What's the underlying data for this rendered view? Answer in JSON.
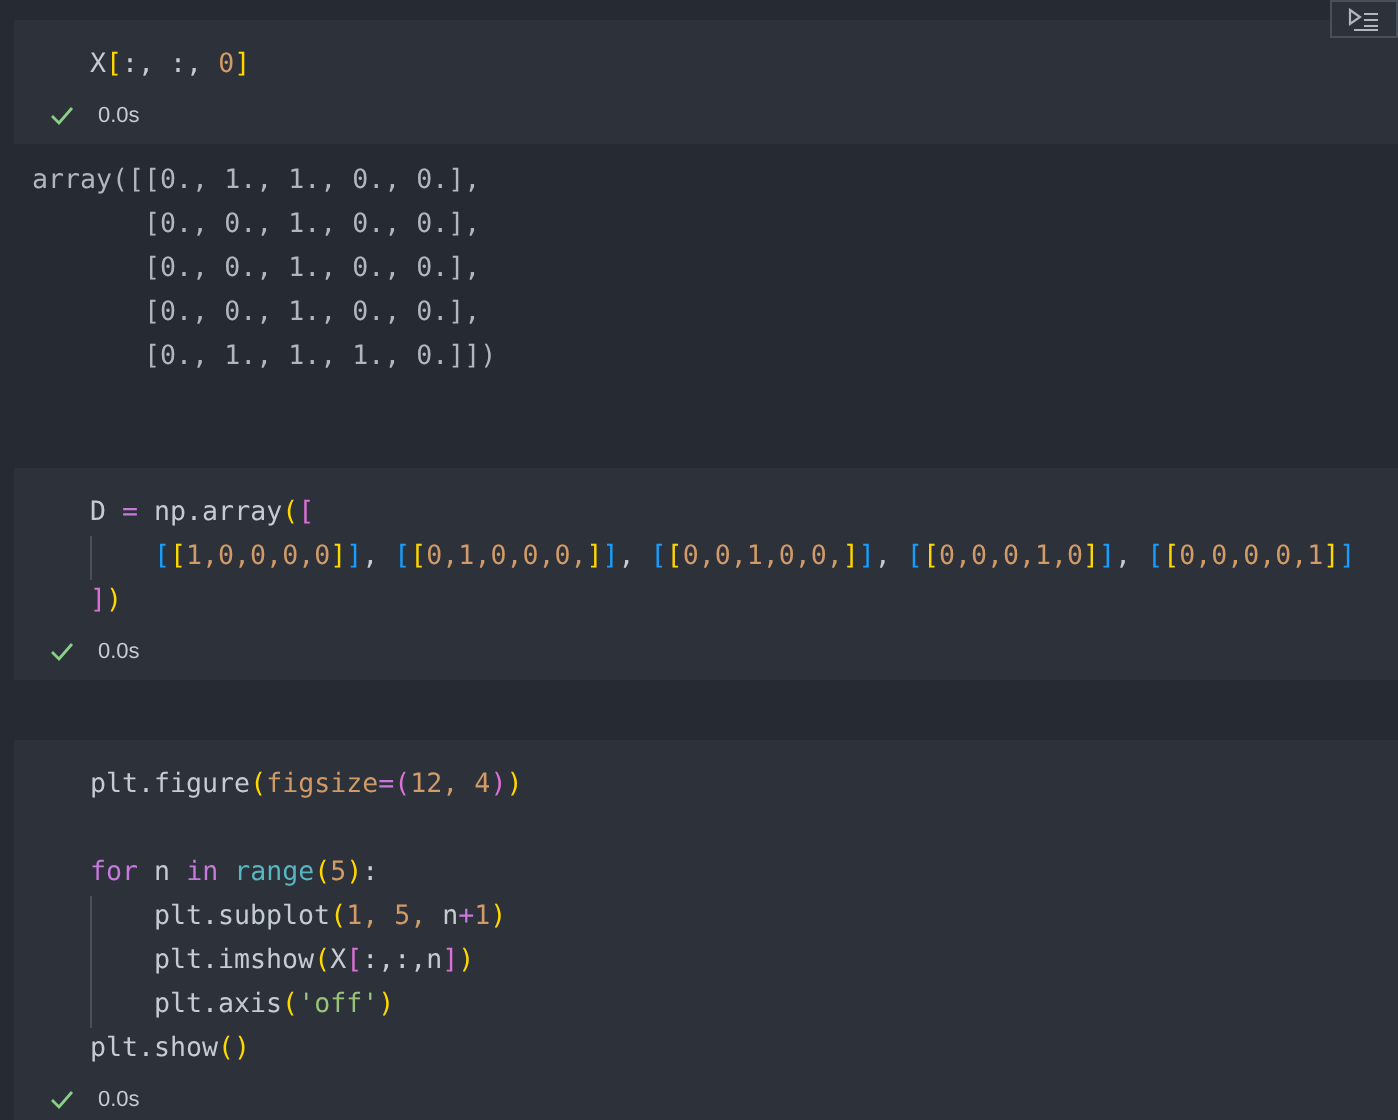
{
  "cells": [
    {
      "code": [
        {
          "tokens": [
            {
              "text": "X",
              "kind": "plain"
            },
            {
              "text": "[",
              "kind": "bracket1"
            },
            {
              "text": ":, :, ",
              "kind": "plain"
            },
            {
              "text": "0",
              "kind": "number"
            },
            {
              "text": "]",
              "kind": "bracket1"
            }
          ]
        }
      ],
      "status": {
        "ok": true,
        "time": "0.0s"
      },
      "output": [
        "array([[0., 1., 1., 0., 0.],",
        "       [0., 0., 1., 0., 0.],",
        "       [0., 0., 1., 0., 0.],",
        "       [0., 0., 1., 0., 0.],",
        "       [0., 1., 1., 1., 0.]])"
      ]
    },
    {
      "code": [
        {
          "tokens": [
            {
              "text": "D ",
              "kind": "plain"
            },
            {
              "text": "=",
              "kind": "operator"
            },
            {
              "text": " np.array",
              "kind": "plain"
            },
            {
              "text": "(",
              "kind": "bracket1"
            },
            {
              "text": "[",
              "kind": "bracket2"
            }
          ]
        },
        {
          "indented": true,
          "tokens": [
            {
              "text": "[",
              "kind": "bracket3"
            },
            {
              "text": "[",
              "kind": "bracket1"
            },
            {
              "text": "1,0,0,0,0",
              "kind": "number"
            },
            {
              "text": "]",
              "kind": "bracket1"
            },
            {
              "text": "]",
              "kind": "bracket3"
            },
            {
              "text": ", ",
              "kind": "plain"
            },
            {
              "text": "[",
              "kind": "bracket3"
            },
            {
              "text": "[",
              "kind": "bracket1"
            },
            {
              "text": "0,1,0,0,0,",
              "kind": "number"
            },
            {
              "text": "]",
              "kind": "bracket1"
            },
            {
              "text": "]",
              "kind": "bracket3"
            },
            {
              "text": ", ",
              "kind": "plain"
            },
            {
              "text": "[",
              "kind": "bracket3"
            },
            {
              "text": "[",
              "kind": "bracket1"
            },
            {
              "text": "0,0,1,0,0,",
              "kind": "number"
            },
            {
              "text": "]",
              "kind": "bracket1"
            },
            {
              "text": "]",
              "kind": "bracket3"
            },
            {
              "text": ", ",
              "kind": "plain"
            },
            {
              "text": "[",
              "kind": "bracket3"
            },
            {
              "text": "[",
              "kind": "bracket1"
            },
            {
              "text": "0,0,0,1,0",
              "kind": "number"
            },
            {
              "text": "]",
              "kind": "bracket1"
            },
            {
              "text": "]",
              "kind": "bracket3"
            },
            {
              "text": ", ",
              "kind": "plain"
            },
            {
              "text": "[",
              "kind": "bracket3"
            },
            {
              "text": "[",
              "kind": "bracket1"
            },
            {
              "text": "0,0,0,0,1",
              "kind": "number"
            },
            {
              "text": "]",
              "kind": "bracket1"
            },
            {
              "text": "]",
              "kind": "bracket3"
            }
          ]
        },
        {
          "tokens": [
            {
              "text": "]",
              "kind": "bracket2"
            },
            {
              "text": ")",
              "kind": "bracket1"
            }
          ]
        }
      ],
      "status": {
        "ok": true,
        "time": "0.0s"
      }
    },
    {
      "code": [
        {
          "tokens": [
            {
              "text": "plt.figure",
              "kind": "plain"
            },
            {
              "text": "(",
              "kind": "bracket1"
            },
            {
              "text": "figsize",
              "kind": "number"
            },
            {
              "text": "=",
              "kind": "operator"
            },
            {
              "text": "(",
              "kind": "bracket2"
            },
            {
              "text": "12, 4",
              "kind": "number"
            },
            {
              "text": ")",
              "kind": "bracket2"
            },
            {
              "text": ")",
              "kind": "bracket1"
            }
          ]
        },
        {
          "gap_before": true,
          "tokens": [
            {
              "text": "for",
              "kind": "keyword"
            },
            {
              "text": " n ",
              "kind": "plain"
            },
            {
              "text": "in",
              "kind": "keyword"
            },
            {
              "text": " range",
              "kind": "function"
            },
            {
              "text": "(",
              "kind": "bracket1"
            },
            {
              "text": "5",
              "kind": "number"
            },
            {
              "text": ")",
              "kind": "bracket1"
            },
            {
              "text": ":",
              "kind": "plain"
            }
          ]
        },
        {
          "indented": true,
          "tokens": [
            {
              "text": "plt.subplot",
              "kind": "plain"
            },
            {
              "text": "(",
              "kind": "bracket1"
            },
            {
              "text": "1, 5, ",
              "kind": "number"
            },
            {
              "text": "n",
              "kind": "plain"
            },
            {
              "text": "+",
              "kind": "operator"
            },
            {
              "text": "1",
              "kind": "number"
            },
            {
              "text": ")",
              "kind": "bracket1"
            }
          ]
        },
        {
          "indented": true,
          "tokens": [
            {
              "text": "plt.imshow",
              "kind": "plain"
            },
            {
              "text": "(",
              "kind": "bracket1"
            },
            {
              "text": "X",
              "kind": "plain"
            },
            {
              "text": "[",
              "kind": "bracket2"
            },
            {
              "text": ":,:,n",
              "kind": "plain"
            },
            {
              "text": "]",
              "kind": "bracket2"
            },
            {
              "text": ")",
              "kind": "bracket1"
            }
          ]
        },
        {
          "indented": true,
          "tokens": [
            {
              "text": "plt.axis",
              "kind": "plain"
            },
            {
              "text": "(",
              "kind": "bracket1"
            },
            {
              "text": "'off'",
              "kind": "string"
            },
            {
              "text": ")",
              "kind": "bracket1"
            }
          ]
        },
        {
          "tokens": [
            {
              "text": "plt.show",
              "kind": "plain"
            },
            {
              "text": "()",
              "kind": "bracket1"
            }
          ]
        }
      ],
      "status": {
        "ok": true,
        "time": "0.0s"
      }
    }
  ]
}
